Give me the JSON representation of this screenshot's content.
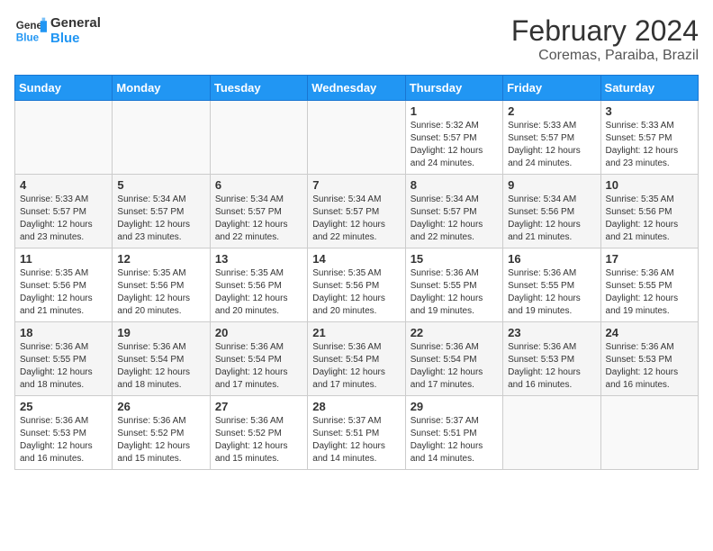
{
  "header": {
    "logo_line1": "General",
    "logo_line2": "Blue",
    "month_title": "February 2024",
    "location": "Coremas, Paraiba, Brazil"
  },
  "weekdays": [
    "Sunday",
    "Monday",
    "Tuesday",
    "Wednesday",
    "Thursday",
    "Friday",
    "Saturday"
  ],
  "weeks": [
    [
      {
        "day": "",
        "sunrise": "",
        "sunset": "",
        "daylight": "",
        "empty": true
      },
      {
        "day": "",
        "sunrise": "",
        "sunset": "",
        "daylight": "",
        "empty": true
      },
      {
        "day": "",
        "sunrise": "",
        "sunset": "",
        "daylight": "",
        "empty": true
      },
      {
        "day": "",
        "sunrise": "",
        "sunset": "",
        "daylight": "",
        "empty": true
      },
      {
        "day": "1",
        "sunrise": "5:32 AM",
        "sunset": "5:57 PM",
        "daylight": "12 hours and 24 minutes.",
        "empty": false
      },
      {
        "day": "2",
        "sunrise": "5:33 AM",
        "sunset": "5:57 PM",
        "daylight": "12 hours and 24 minutes.",
        "empty": false
      },
      {
        "day": "3",
        "sunrise": "5:33 AM",
        "sunset": "5:57 PM",
        "daylight": "12 hours and 23 minutes.",
        "empty": false
      }
    ],
    [
      {
        "day": "4",
        "sunrise": "5:33 AM",
        "sunset": "5:57 PM",
        "daylight": "12 hours and 23 minutes.",
        "empty": false
      },
      {
        "day": "5",
        "sunrise": "5:34 AM",
        "sunset": "5:57 PM",
        "daylight": "12 hours and 23 minutes.",
        "empty": false
      },
      {
        "day": "6",
        "sunrise": "5:34 AM",
        "sunset": "5:57 PM",
        "daylight": "12 hours and 22 minutes.",
        "empty": false
      },
      {
        "day": "7",
        "sunrise": "5:34 AM",
        "sunset": "5:57 PM",
        "daylight": "12 hours and 22 minutes.",
        "empty": false
      },
      {
        "day": "8",
        "sunrise": "5:34 AM",
        "sunset": "5:57 PM",
        "daylight": "12 hours and 22 minutes.",
        "empty": false
      },
      {
        "day": "9",
        "sunrise": "5:34 AM",
        "sunset": "5:56 PM",
        "daylight": "12 hours and 21 minutes.",
        "empty": false
      },
      {
        "day": "10",
        "sunrise": "5:35 AM",
        "sunset": "5:56 PM",
        "daylight": "12 hours and 21 minutes.",
        "empty": false
      }
    ],
    [
      {
        "day": "11",
        "sunrise": "5:35 AM",
        "sunset": "5:56 PM",
        "daylight": "12 hours and 21 minutes.",
        "empty": false
      },
      {
        "day": "12",
        "sunrise": "5:35 AM",
        "sunset": "5:56 PM",
        "daylight": "12 hours and 20 minutes.",
        "empty": false
      },
      {
        "day": "13",
        "sunrise": "5:35 AM",
        "sunset": "5:56 PM",
        "daylight": "12 hours and 20 minutes.",
        "empty": false
      },
      {
        "day": "14",
        "sunrise": "5:35 AM",
        "sunset": "5:56 PM",
        "daylight": "12 hours and 20 minutes.",
        "empty": false
      },
      {
        "day": "15",
        "sunrise": "5:36 AM",
        "sunset": "5:55 PM",
        "daylight": "12 hours and 19 minutes.",
        "empty": false
      },
      {
        "day": "16",
        "sunrise": "5:36 AM",
        "sunset": "5:55 PM",
        "daylight": "12 hours and 19 minutes.",
        "empty": false
      },
      {
        "day": "17",
        "sunrise": "5:36 AM",
        "sunset": "5:55 PM",
        "daylight": "12 hours and 19 minutes.",
        "empty": false
      }
    ],
    [
      {
        "day": "18",
        "sunrise": "5:36 AM",
        "sunset": "5:55 PM",
        "daylight": "12 hours and 18 minutes.",
        "empty": false
      },
      {
        "day": "19",
        "sunrise": "5:36 AM",
        "sunset": "5:54 PM",
        "daylight": "12 hours and 18 minutes.",
        "empty": false
      },
      {
        "day": "20",
        "sunrise": "5:36 AM",
        "sunset": "5:54 PM",
        "daylight": "12 hours and 17 minutes.",
        "empty": false
      },
      {
        "day": "21",
        "sunrise": "5:36 AM",
        "sunset": "5:54 PM",
        "daylight": "12 hours and 17 minutes.",
        "empty": false
      },
      {
        "day": "22",
        "sunrise": "5:36 AM",
        "sunset": "5:54 PM",
        "daylight": "12 hours and 17 minutes.",
        "empty": false
      },
      {
        "day": "23",
        "sunrise": "5:36 AM",
        "sunset": "5:53 PM",
        "daylight": "12 hours and 16 minutes.",
        "empty": false
      },
      {
        "day": "24",
        "sunrise": "5:36 AM",
        "sunset": "5:53 PM",
        "daylight": "12 hours and 16 minutes.",
        "empty": false
      }
    ],
    [
      {
        "day": "25",
        "sunrise": "5:36 AM",
        "sunset": "5:53 PM",
        "daylight": "12 hours and 16 minutes.",
        "empty": false
      },
      {
        "day": "26",
        "sunrise": "5:36 AM",
        "sunset": "5:52 PM",
        "daylight": "12 hours and 15 minutes.",
        "empty": false
      },
      {
        "day": "27",
        "sunrise": "5:36 AM",
        "sunset": "5:52 PM",
        "daylight": "12 hours and 15 minutes.",
        "empty": false
      },
      {
        "day": "28",
        "sunrise": "5:37 AM",
        "sunset": "5:51 PM",
        "daylight": "12 hours and 14 minutes.",
        "empty": false
      },
      {
        "day": "29",
        "sunrise": "5:37 AM",
        "sunset": "5:51 PM",
        "daylight": "12 hours and 14 minutes.",
        "empty": false
      },
      {
        "day": "",
        "sunrise": "",
        "sunset": "",
        "daylight": "",
        "empty": true
      },
      {
        "day": "",
        "sunrise": "",
        "sunset": "",
        "daylight": "",
        "empty": true
      }
    ]
  ]
}
